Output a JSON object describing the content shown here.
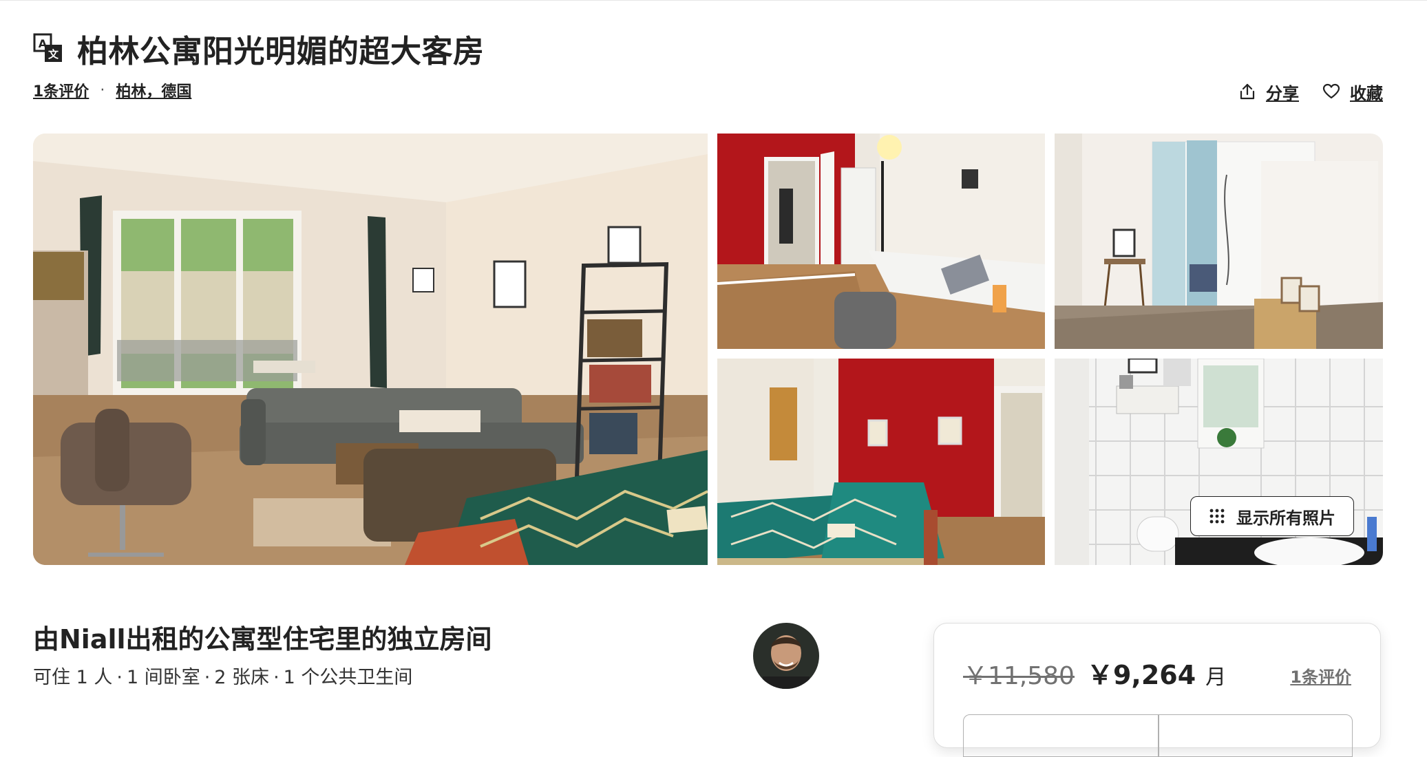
{
  "header": {
    "title": "柏林公寓阳光明媚的超大客房",
    "reviews_link": "1条评价",
    "location_link": "柏林，德国",
    "meta_separator": "·",
    "share_label": "分享",
    "save_label": "收藏"
  },
  "gallery": {
    "show_all_label": "显示所有照片",
    "photos": [
      "living-room",
      "desk-room",
      "hallway",
      "bedroom",
      "bathroom"
    ]
  },
  "listing": {
    "title": "由Niall出租的公寓型住宅里的独立房间",
    "details": [
      "可住 1 人",
      "1 间卧室",
      "2 张床",
      "1 个公共卫生间"
    ],
    "details_separator": "·"
  },
  "price_card": {
    "original_price": "￥11,580",
    "price": "￥9,264",
    "period": "月",
    "reviews_link": "1条评价"
  },
  "icons": {
    "translate": "translate-icon",
    "share": "share-icon",
    "save": "heart-icon",
    "show_all": "grid-dots-icon"
  },
  "colors": {
    "text": "#222222",
    "muted": "#717171",
    "red_wall": "#b3161b"
  }
}
